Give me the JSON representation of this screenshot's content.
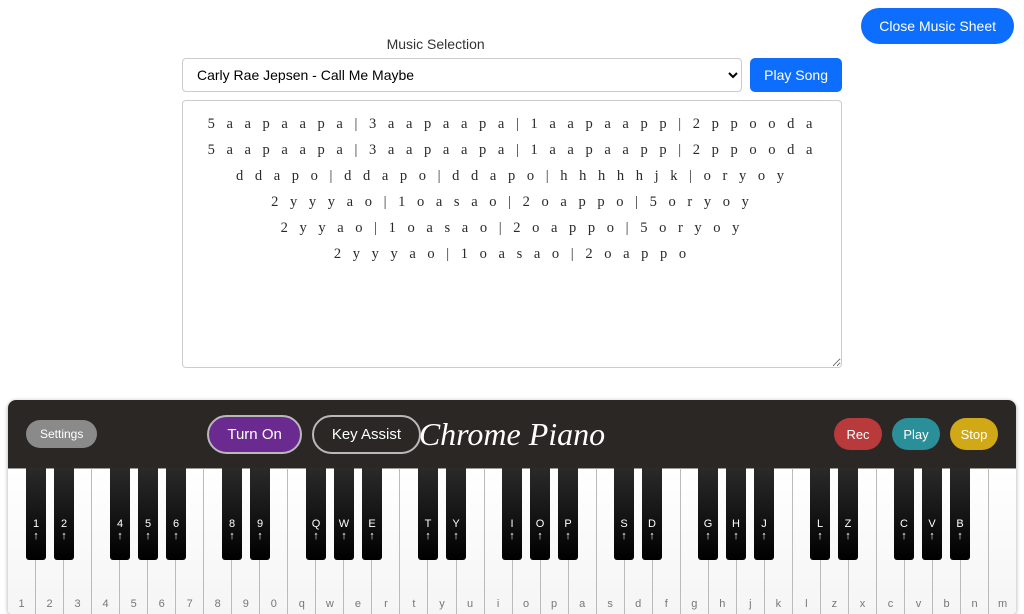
{
  "close_label": "Close Music Sheet",
  "selection_label": "Music Selection",
  "song_selected": "Carly Rae Jepsen - Call Me Maybe",
  "play_song_label": "Play Song",
  "sheet_lines": [
    "5 a a p a a p a | 3 a a p a a p a | 1 a a p a a p p | 2 p p o o d a",
    "5 a a p a a p a | 3 a a p a a p a | 1 a a p a a p p | 2 p p o o d a",
    "d d a p o | d d a p o | d d a p o | h h h h h j k | o r y o y",
    "2 y y y a o | 1 o a s a o | 2 o a p p o | 5 o r y o y",
    "2 y y a o | 1 o a s a o | 2 o a p p o | 5 o r y o y",
    "2 y y y a o | 1 o a s a o | 2 o a p p o"
  ],
  "toolbar": {
    "settings": "Settings",
    "turn_on": "Turn On",
    "key_assist": "Key Assist",
    "title": "Chrome Piano",
    "rec": "Rec",
    "play": "Play",
    "stop": "Stop"
  },
  "white_keys": [
    "1",
    "2",
    "3",
    "4",
    "5",
    "6",
    "7",
    "8",
    "9",
    "0",
    "q",
    "w",
    "e",
    "r",
    "t",
    "y",
    "u",
    "i",
    "o",
    "p",
    "a",
    "s",
    "d",
    "f",
    "g",
    "h",
    "j",
    "k",
    "l",
    "z",
    "x",
    "c",
    "v",
    "b",
    "n",
    "m"
  ],
  "black_keys": [
    {
      "after": 0,
      "label": "1"
    },
    {
      "after": 1,
      "label": "2"
    },
    {
      "after": 3,
      "label": "4"
    },
    {
      "after": 4,
      "label": "5"
    },
    {
      "after": 5,
      "label": "6"
    },
    {
      "after": 7,
      "label": "8"
    },
    {
      "after": 8,
      "label": "9"
    },
    {
      "after": 10,
      "label": "Q"
    },
    {
      "after": 11,
      "label": "W"
    },
    {
      "after": 12,
      "label": "E"
    },
    {
      "after": 14,
      "label": "T"
    },
    {
      "after": 15,
      "label": "Y"
    },
    {
      "after": 17,
      "label": "I"
    },
    {
      "after": 18,
      "label": "O"
    },
    {
      "after": 19,
      "label": "P"
    },
    {
      "after": 21,
      "label": "S"
    },
    {
      "after": 22,
      "label": "D"
    },
    {
      "after": 24,
      "label": "G"
    },
    {
      "after": 25,
      "label": "H"
    },
    {
      "after": 26,
      "label": "J"
    },
    {
      "after": 28,
      "label": "L"
    },
    {
      "after": 29,
      "label": "Z"
    },
    {
      "after": 31,
      "label": "C"
    },
    {
      "after": 32,
      "label": "V"
    },
    {
      "after": 33,
      "label": "B"
    }
  ]
}
